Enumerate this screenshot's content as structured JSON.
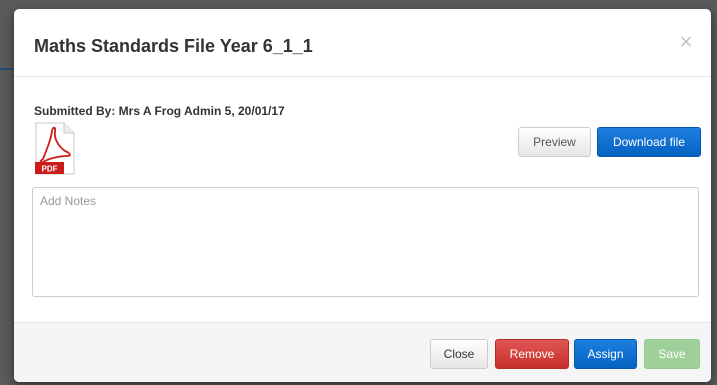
{
  "modal": {
    "title": "Maths Standards File Year 6_1_1",
    "close_icon": "×",
    "submitted_by": "Submitted By: Mrs A Frog Admin 5, 20/01/17",
    "file_icon": "pdf-file-icon",
    "file_icon_label": "PDF",
    "preview_label": "Preview",
    "download_label": "Download file",
    "notes_placeholder": "Add Notes",
    "notes_value": ""
  },
  "footer": {
    "close_label": "Close",
    "remove_label": "Remove",
    "assign_label": "Assign",
    "save_label": "Save"
  },
  "colors": {
    "primary": "#0563c1",
    "danger": "#c9302c",
    "success_disabled": "#9fd09a",
    "pdf_red": "#cc1b1b"
  }
}
